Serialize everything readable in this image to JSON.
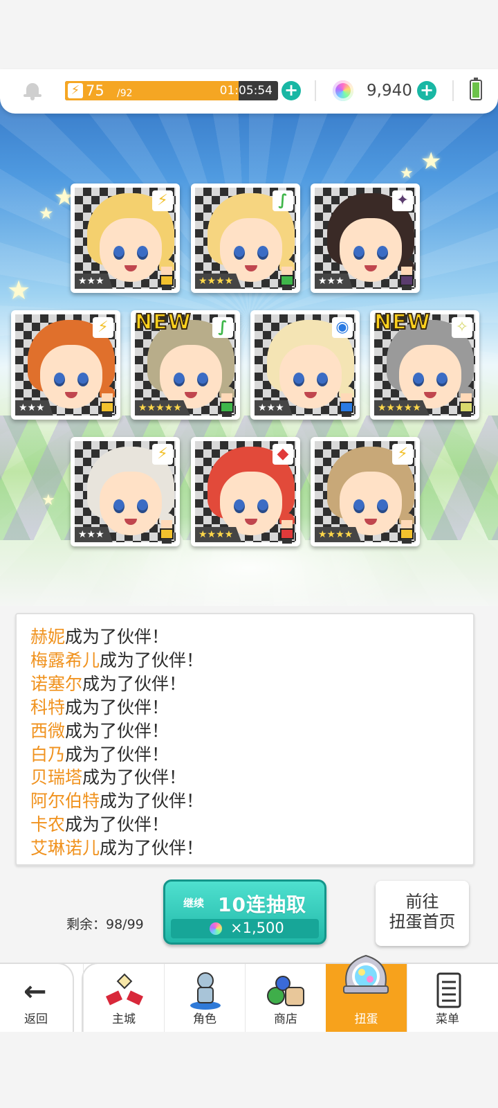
{
  "status_bar": {
    "stamina_current": "75",
    "stamina_max": "/92",
    "stamina_fraction": 0.815,
    "stamina_timer": "01:05:54",
    "gems": "9,940",
    "icons": {
      "bell": "bell-icon",
      "bolt": "lightning-icon",
      "gem": "rainbow-gem-icon",
      "battery": "battery-icon",
      "plus": "plus-icon"
    }
  },
  "cards": [
    {
      "stars": "★★★",
      "attribute": "⚡",
      "attr_color": "#f2c12e",
      "new_label": "",
      "hair": "#f4d06e"
    },
    {
      "stars": "★★★★",
      "attribute": "∫",
      "attr_color": "#3fb64a",
      "new_label": "",
      "hair": "#f6d580"
    },
    {
      "stars": "★★★",
      "attribute": "✦",
      "attr_color": "#5a3c6e",
      "new_label": "",
      "hair": "#3a2a26"
    },
    {
      "stars": "★★★",
      "attribute": "⚡",
      "attr_color": "#f2c12e",
      "new_label": "",
      "hair": "#e0702c"
    },
    {
      "stars": "★★★★★",
      "attribute": "∫",
      "attr_color": "#3fb64a",
      "new_label": "NEW",
      "hair": "#b8ad8a"
    },
    {
      "stars": "★★★",
      "attribute": "◉",
      "attr_color": "#2a7ae2",
      "new_label": "",
      "hair": "#f4e4b4"
    },
    {
      "stars": "★★★★★",
      "attribute": "✧",
      "attr_color": "#d8d86c",
      "new_label": "NEW",
      "hair": "#9a9a9a"
    },
    {
      "stars": "★★★",
      "attribute": "⚡",
      "attr_color": "#f2c12e",
      "new_label": "",
      "hair": "#e8e4dc"
    },
    {
      "stars": "★★★★",
      "attribute": "◆",
      "attr_color": "#e03a3a",
      "new_label": "",
      "hair": "#e24a3a"
    },
    {
      "stars": "★★★★",
      "attribute": "⚡",
      "attr_color": "#f2c12e",
      "new_label": "",
      "hair": "#c8a878"
    }
  ],
  "log": {
    "suffix": "成为了伙伴！",
    "names": [
      "赫妮",
      "梅露希儿",
      "诺塞尔",
      "科特",
      "西微",
      "白乃",
      "贝瑞塔",
      "阿尔伯特",
      "卡农",
      "艾琳诺儿"
    ]
  },
  "actions": {
    "remaining": "剩余：98/99",
    "pull_continue": "继续",
    "pull_main": "10连抽取",
    "pull_cost": "×1,500",
    "home_line1": "前往",
    "home_line2": "扭蛋首页"
  },
  "nav": {
    "back": "返回",
    "tabs": [
      {
        "label": "主城",
        "icon": "castle-icon",
        "active": false
      },
      {
        "label": "角色",
        "icon": "character-icon",
        "active": false
      },
      {
        "label": "商店",
        "icon": "shop-icon",
        "active": false
      },
      {
        "label": "扭蛋",
        "icon": "gacha-icon",
        "active": true
      },
      {
        "label": "菜单",
        "icon": "menu-icon",
        "active": false
      }
    ]
  },
  "colors": {
    "accent": "#19b7a4",
    "orange": "#f5a623",
    "name_color": "#f0921e"
  }
}
